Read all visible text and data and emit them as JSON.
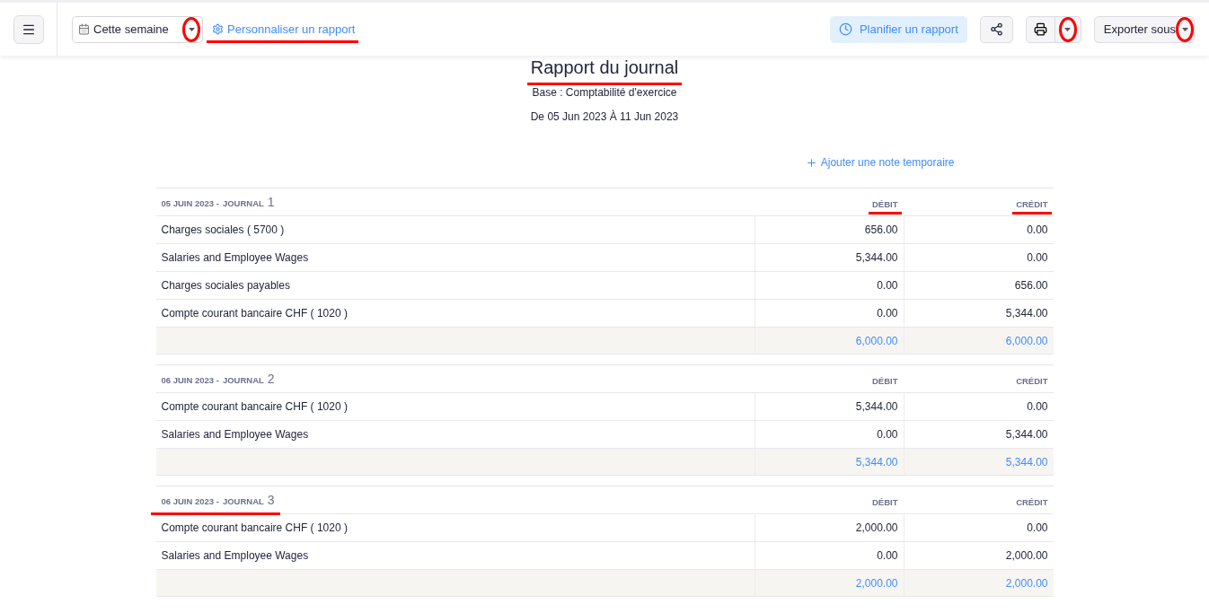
{
  "toolbar": {
    "period_select": {
      "value": "Cette semaine",
      "marked": true
    },
    "customize_link": {
      "label": "Personnaliser un rapport",
      "marked": true
    },
    "schedule_button": {
      "label": "Planifier un rapport"
    },
    "print_button": {
      "marked": true
    },
    "export_button": {
      "label": "Exporter sous",
      "marked": true
    }
  },
  "report": {
    "title": {
      "text": "Rapport du journal",
      "marked": true
    },
    "basis": "Base : Comptabilité d'exercice",
    "date_range": "De 05 Jun 2023 À 11 Jun 2023",
    "add_note": "Ajouter une note temporaire"
  },
  "journals": [
    {
      "date": "05 JUIN 2023 -",
      "label": "JOURNAL",
      "number": "1",
      "marked": false,
      "columns": [
        {
          "label": "DÉBIT",
          "marked": true
        },
        {
          "label": "CRÉDIT",
          "marked": true
        }
      ],
      "rows": [
        {
          "account": "Charges sociales ( 5700 )",
          "debit": "656.00",
          "credit": "0.00"
        },
        {
          "account": "Salaries and Employee Wages",
          "debit": "5,344.00",
          "credit": "0.00"
        },
        {
          "account": "Charges sociales payables",
          "debit": "0.00",
          "credit": "656.00"
        },
        {
          "account": "Compte courant bancaire CHF ( 1020 )",
          "debit": "0.00",
          "credit": "5,344.00"
        }
      ],
      "total": {
        "debit": "6,000.00",
        "credit": "6,000.00"
      }
    },
    {
      "date": "06 JUIN 2023 -",
      "label": "JOURNAL",
      "number": "2",
      "marked": false,
      "columns": [
        {
          "label": "DÉBIT",
          "marked": false
        },
        {
          "label": "CRÉDIT",
          "marked": false
        }
      ],
      "rows": [
        {
          "account": "Compte courant bancaire CHF ( 1020 )",
          "debit": "5,344.00",
          "credit": "0.00"
        },
        {
          "account": "Salaries and Employee Wages",
          "debit": "0.00",
          "credit": "5,344.00"
        }
      ],
      "total": {
        "debit": "5,344.00",
        "credit": "5,344.00"
      }
    },
    {
      "date": "06 JUIN 2023 -",
      "label": "JOURNAL",
      "number": "3",
      "marked": true,
      "columns": [
        {
          "label": "DÉBIT",
          "marked": false
        },
        {
          "label": "CRÉDIT",
          "marked": false
        }
      ],
      "rows": [
        {
          "account": "Compte courant bancaire CHF ( 1020 )",
          "debit": "2,000.00",
          "credit": "0.00"
        },
        {
          "account": "Salaries and Employee Wages",
          "debit": "0.00",
          "credit": "2,000.00"
        }
      ],
      "total": {
        "debit": "2,000.00",
        "credit": "2,000.00"
      }
    }
  ]
}
